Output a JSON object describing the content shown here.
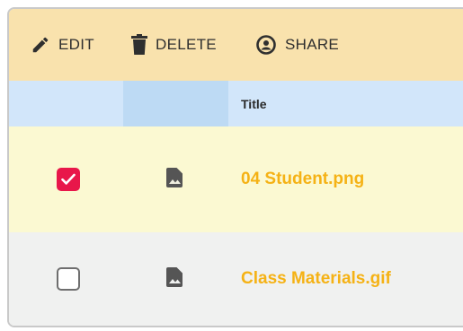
{
  "toolbar": {
    "edit_label": "EDIT",
    "delete_label": "DELETE",
    "share_label": "SHARE",
    "edit_icon": "pencil-icon",
    "delete_icon": "trash-icon",
    "share_icon": "share-icon"
  },
  "table": {
    "columns": {
      "title": "Title"
    },
    "rows": [
      {
        "title": "04 Student.png",
        "checked": true,
        "icon": "image-file-icon"
      },
      {
        "title": "Class Materials.gif",
        "checked": false,
        "icon": "image-file-icon"
      }
    ]
  },
  "colors": {
    "toolbar_bg": "#f9e2ad",
    "header_bg": "#d2e6fa",
    "selected_row_bg": "#fbf9d2",
    "row_bg": "#f0f1f0",
    "title_color": "#f5b215",
    "checkbox_checked": "#e8174a"
  }
}
